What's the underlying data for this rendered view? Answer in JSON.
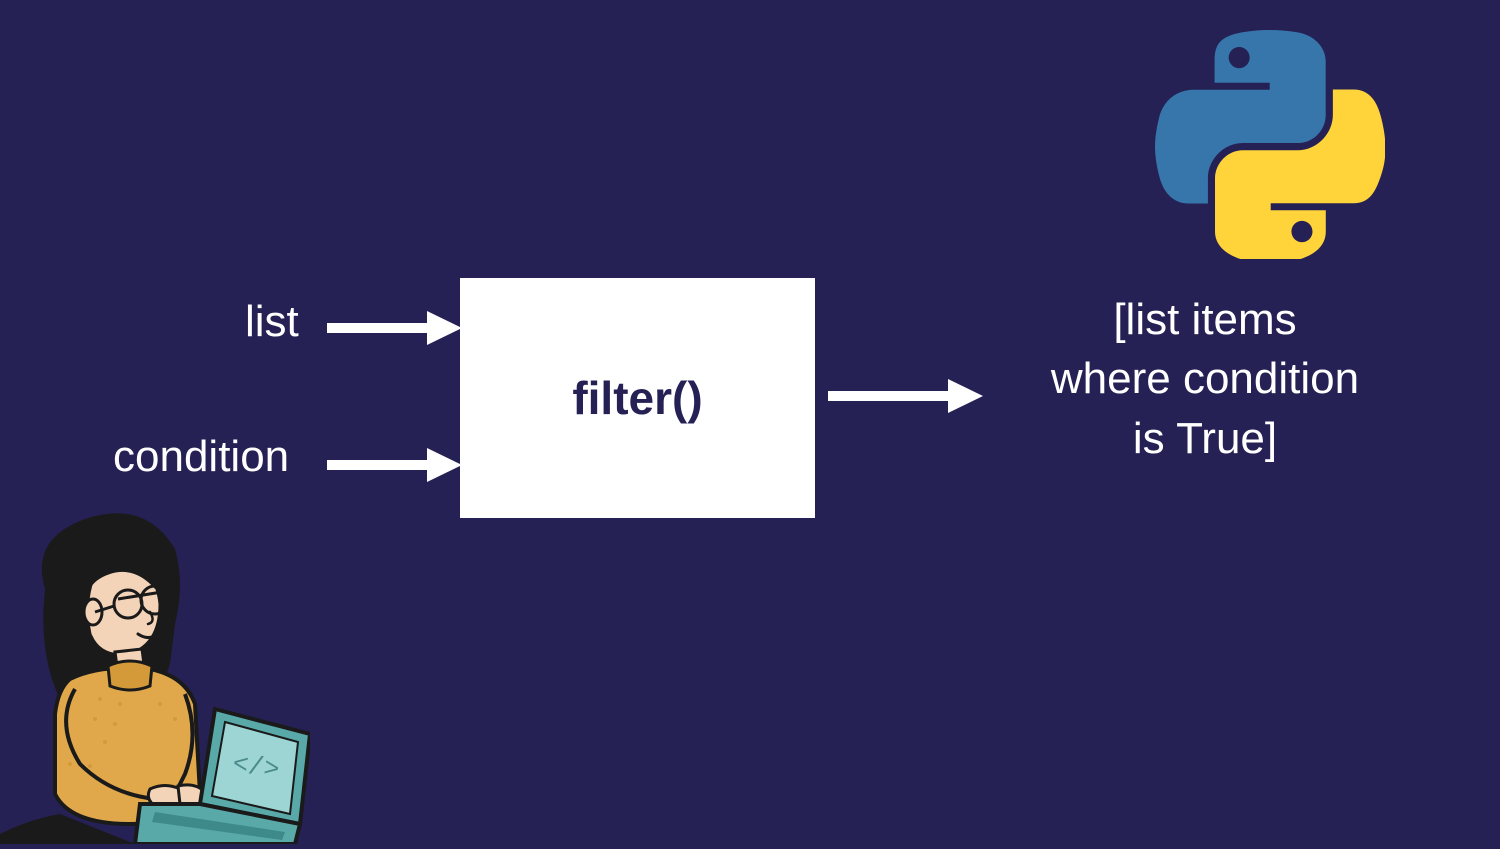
{
  "inputs": {
    "first": "list",
    "second": "condition"
  },
  "box": {
    "label": "filter()"
  },
  "output": {
    "line1": "[list items",
    "line2": "where condition",
    "line3": "is True]"
  },
  "icons": {
    "logo": "python-logo",
    "coder": "person-coding-illustration",
    "laptop_text": "</>"
  },
  "colors": {
    "bg": "#262154",
    "box_bg": "#ffffff",
    "box_fg": "#262154",
    "text": "#ffffff",
    "python_blue": "#3776ab",
    "python_yellow": "#ffd43b"
  }
}
